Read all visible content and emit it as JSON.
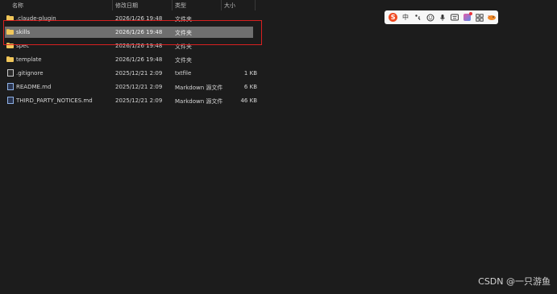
{
  "header": {
    "name": "名称",
    "modified": "修改日期",
    "type": "类型",
    "size": "大小"
  },
  "rows": [
    {
      "name": ".claude-plugin",
      "modified": "2026/1/26 19:48",
      "type": "文件夹",
      "size": "",
      "icon": "folder-icon"
    },
    {
      "name": "skills",
      "modified": "2026/1/26 19:48",
      "type": "文件夹",
      "size": "",
      "icon": "folder-icon",
      "selected": true
    },
    {
      "name": "spec",
      "modified": "2026/1/26 19:48",
      "type": "文件夹",
      "size": "",
      "icon": "folder-icon"
    },
    {
      "name": "template",
      "modified": "2026/1/26 19:48",
      "type": "文件夹",
      "size": "",
      "icon": "folder-icon"
    },
    {
      "name": ".gitignore",
      "modified": "2025/12/21 2:09",
      "type": "txtfile",
      "size": "1 KB",
      "icon": "file-icon"
    },
    {
      "name": "README.md",
      "modified": "2025/12/21 2:09",
      "type": "Markdown 源文件",
      "size": "6 KB",
      "icon": "markdown-icon"
    },
    {
      "name": "THIRD_PARTY_NOTICES.md",
      "modified": "2025/12/21 2:09",
      "type": "Markdown 源文件",
      "size": "46 KB",
      "icon": "markdown-icon"
    }
  ],
  "ime_toolbar": {
    "logo": "S",
    "lang": "中",
    "items": [
      "punctuation-icon",
      "emoji-icon",
      "microphone-icon",
      "keyboard-icon",
      "skin-icon",
      "toolbox-icon",
      "bird-icon"
    ]
  },
  "watermark": "CSDN @一只游鱼",
  "colors": {
    "background": "#1c1c1c",
    "selection": "#6f6f6f",
    "highlight_border": "#d82020",
    "folder": "#f0c65a"
  }
}
